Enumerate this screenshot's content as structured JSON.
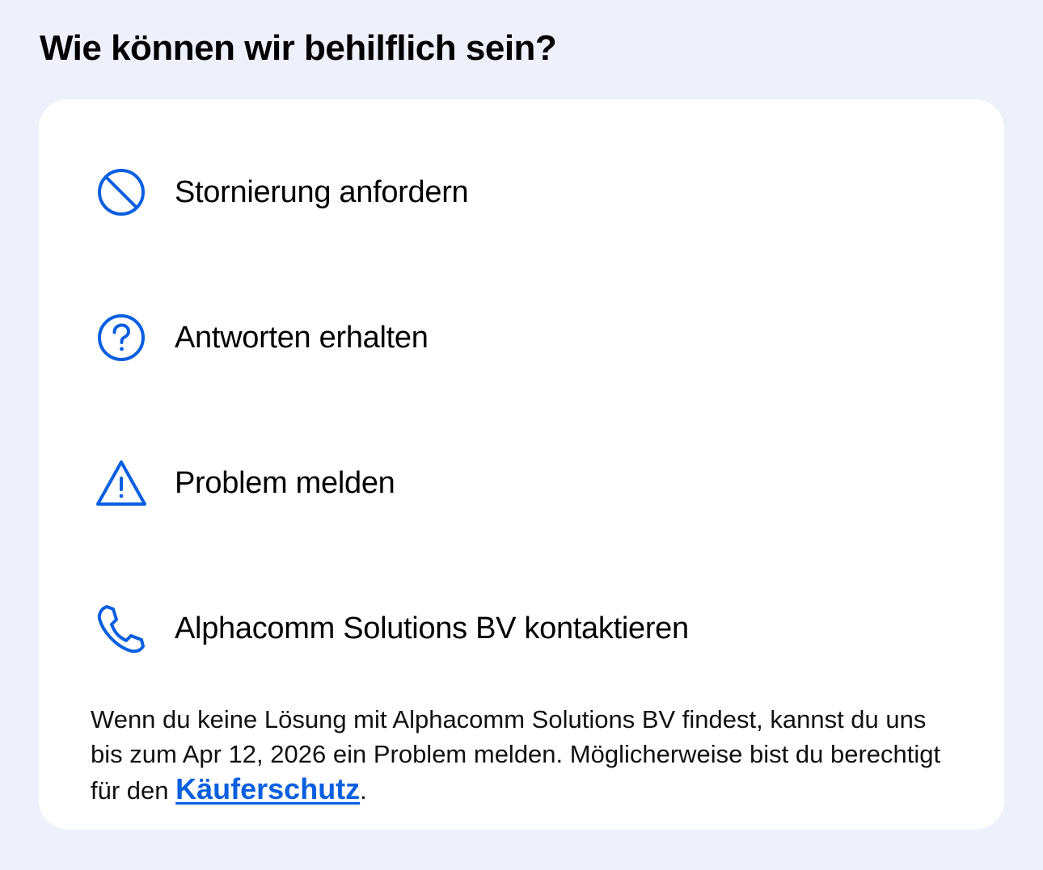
{
  "page_title": "Wie können wir behilflich sein?",
  "colors": {
    "background": "#eef0fb",
    "card": "#ffffff",
    "accent": "#0a5fe0"
  },
  "options": [
    {
      "icon": "cancel-circle-icon",
      "label": "Stornierung anfordern"
    },
    {
      "icon": "question-circle-icon",
      "label": "Antworten erhalten"
    },
    {
      "icon": "warning-triangle-icon",
      "label": "Problem melden"
    },
    {
      "icon": "phone-icon",
      "label": "Alphacomm Solutions BV kontaktieren"
    }
  ],
  "footnote": {
    "text": "Wenn du keine Lösung mit Alphacomm Solutions BV findest, kannst du uns bis zum Apr 12, 2026 ein Problem melden. Möglicherweise bist du berechtigt für den ",
    "link_label": "Käuferschutz",
    "suffix": "."
  }
}
